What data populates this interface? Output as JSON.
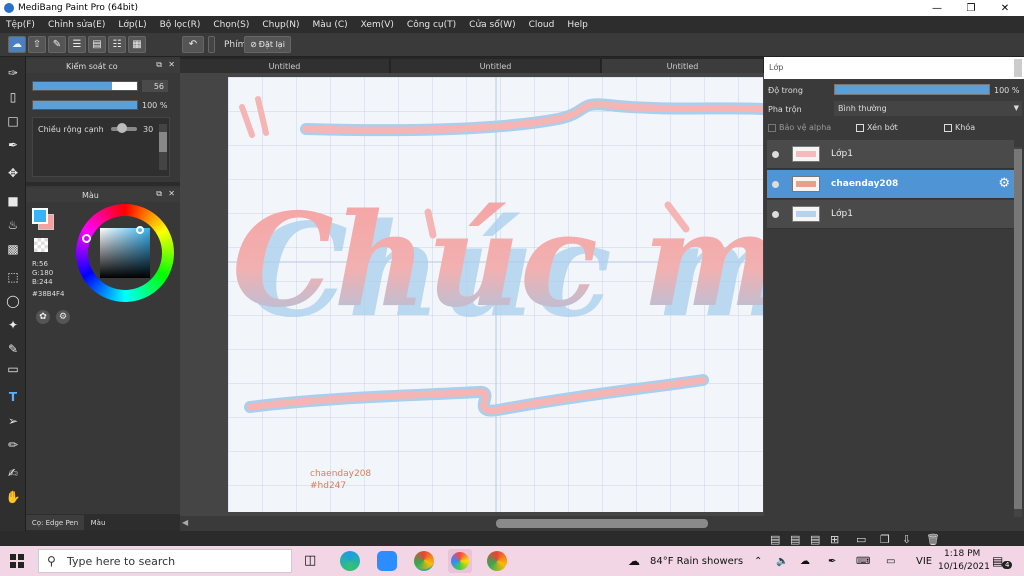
{
  "app": {
    "title": "MediBang Paint Pro (64bit)"
  },
  "menu": [
    "Tệp(F)",
    "Chỉnh sửa(E)",
    "Lớp(L)",
    "Bộ lọc(R)",
    "Chọn(S)",
    "Chụp(N)",
    "Màu (C)",
    "Xem(V)",
    "Công cụ(T)",
    "Cửa sổ(W)",
    "Cloud",
    "Help"
  ],
  "toolbar": {
    "brush_label": "Phím",
    "reset_label": "Đặt lại"
  },
  "brush_panel": {
    "title": "Kiểm soát co",
    "size_value": "56",
    "opacity_value": "100 %",
    "edge_label": "Chiều rộng cạnh",
    "edge_value": "30"
  },
  "color_panel": {
    "title": "Màu",
    "r": "R:56",
    "g": "G:180",
    "b": "B:244",
    "hex": "#38B4F4",
    "primary_color": "#38b4f4",
    "secondary_color": "#f4a3a3"
  },
  "bottom_tabs": {
    "brush": "Cọ: Edge Pen",
    "color": "Màu"
  },
  "tabs": [
    "Untitled",
    "Untitled",
    "Untitled"
  ],
  "canvas": {
    "main_text": "Chúc mừn",
    "watermark_line1": "chaenday208",
    "watermark_line2": "#hd247"
  },
  "layers_panel": {
    "title": "Lớp",
    "opacity_label": "Độ trong",
    "opacity_value": "100 %",
    "opacity_fraction": 1.0,
    "blend_label": "Pha trộn",
    "blend_value": "Bình thường",
    "protect_alpha": "Bảo vệ alpha",
    "clip": "Xén bớt",
    "lock": "Khóa",
    "layers": [
      {
        "name": "Lớp1",
        "selected": false
      },
      {
        "name": "chaenday208",
        "selected": true
      },
      {
        "name": "Lớp1",
        "selected": false
      }
    ]
  },
  "taskbar": {
    "search_placeholder": "Type here to search",
    "weather": "84°F  Rain showers",
    "lang": "VIE",
    "time": "1:18 PM",
    "date": "10/16/2021",
    "notification_count": "4"
  }
}
